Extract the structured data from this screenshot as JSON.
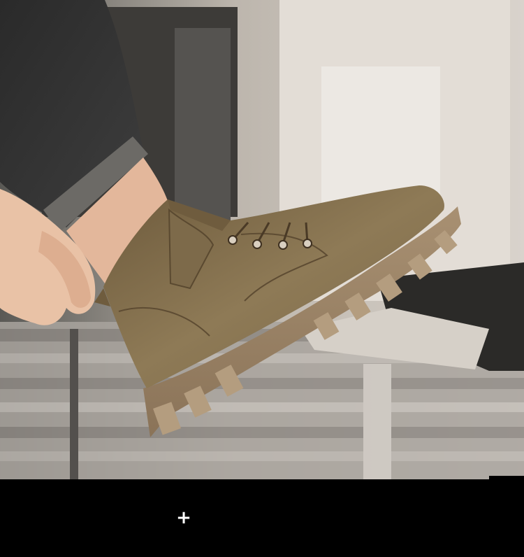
{
  "image": {
    "subject": "boot-product-photo",
    "colors": {
      "leather": "#8a7452",
      "sole": "#9c8463",
      "background": "#cfc7bd",
      "footer": "#000000"
    }
  },
  "footer": {
    "action_icon": "plus-icon",
    "action_glyph": "+"
  }
}
